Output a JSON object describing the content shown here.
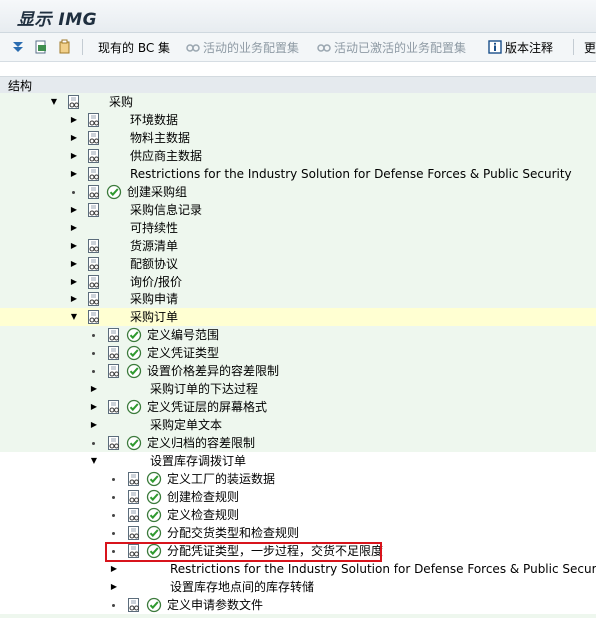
{
  "window": {
    "title": "显示 IMG"
  },
  "toolbar": {
    "current_bc_sets": "现有的 BC 集",
    "active_bc_sets": "活动的业务配置集",
    "activated_bc_sets": "活动已激活的业务配置集",
    "release_notes": "版本注释",
    "more": "更"
  },
  "structure_header": "结构",
  "tree": {
    "rows": [
      {
        "label": "采购",
        "expander": "open"
      },
      {
        "label": "环境数据",
        "expander": "closed"
      },
      {
        "label": "物料主数据",
        "expander": "closed"
      },
      {
        "label": "供应商主数据",
        "expander": "closed"
      },
      {
        "label": "Restrictions for the Industry Solution for Defense Forces & Public Security",
        "expander": "closed"
      },
      {
        "label": "创建采购组",
        "expander": "leaf"
      },
      {
        "label": "采购信息记录",
        "expander": "closed"
      },
      {
        "label": "可持续性",
        "expander": "closed"
      },
      {
        "label": "货源清单",
        "expander": "closed"
      },
      {
        "label": "配额协议",
        "expander": "closed"
      },
      {
        "label": "询价/报价",
        "expander": "closed"
      },
      {
        "label": "采购申请",
        "expander": "closed"
      },
      {
        "label": "采购订单",
        "expander": "open"
      },
      {
        "label": "定义编号范围",
        "expander": "leaf"
      },
      {
        "label": "定义凭证类型",
        "expander": "leaf"
      },
      {
        "label": "设置价格差异的容差限制",
        "expander": "leaf"
      },
      {
        "label": "采购订单的下达过程",
        "expander": "closed"
      },
      {
        "label": "定义凭证层的屏幕格式",
        "expander": "closed"
      },
      {
        "label": "采购定单文本",
        "expander": "closed"
      },
      {
        "label": "定义归档的容差限制",
        "expander": "leaf"
      },
      {
        "label": "设置库存调拨订单",
        "expander": "open"
      },
      {
        "label": "定义工厂的装运数据",
        "expander": "leaf"
      },
      {
        "label": "创建检查规则",
        "expander": "leaf"
      },
      {
        "label": "定义检查规则",
        "expander": "leaf"
      },
      {
        "label": "分配交货类型和检查规则",
        "expander": "leaf"
      },
      {
        "label": "分配凭证类型，一步过程，交货不足限度",
        "expander": "leaf"
      },
      {
        "label": "Restrictions for the Industry Solution for Defense Forces & Public Security",
        "expander": "closed"
      },
      {
        "label": "设置库存地点间的库存转储",
        "expander": "closed"
      },
      {
        "label": "定义申请参数文件",
        "expander": "leaf"
      }
    ]
  },
  "colors": {
    "tree_bg": "#eef7ee",
    "selected_row": "#ffffd2",
    "highlight_border": "#d8141c"
  }
}
